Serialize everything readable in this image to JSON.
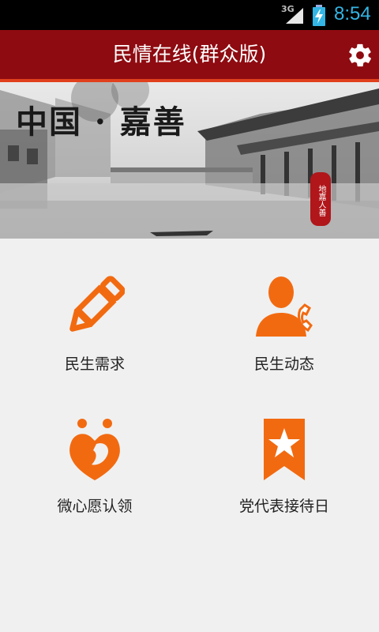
{
  "status_bar": {
    "network": "3G",
    "time": "8:54",
    "icons": [
      "signal-icon",
      "battery-charging-icon"
    ]
  },
  "app_bar": {
    "title": "民情在线(群众版)",
    "settings_icon": "gear-icon"
  },
  "banner": {
    "calligraphy": "中国 · 嘉善",
    "seal_text": "地嘉人善"
  },
  "menu": {
    "items": [
      {
        "label": "民生需求",
        "icon": "pencil-icon"
      },
      {
        "label": "民生动态",
        "icon": "person-phone-icon"
      },
      {
        "label": "微心愿认领",
        "icon": "heart-people-icon"
      },
      {
        "label": "党代表接待日",
        "icon": "star-bookmark-icon"
      }
    ]
  },
  "colors": {
    "app_bar": "#8e0b11",
    "accent": "#f26a10",
    "time": "#33b5e5",
    "background": "#f0f0f0"
  }
}
